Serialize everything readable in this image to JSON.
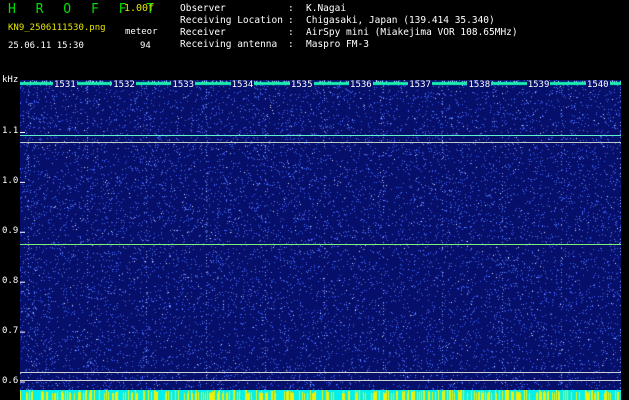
{
  "header": {
    "app_name": "H R O F F T",
    "version": "1.00f",
    "filename": "KN9_2506111530.png",
    "mode": "meteor",
    "datetime": "25.06.11 15:30",
    "count": "94",
    "info": [
      {
        "label": "Observer",
        "value": "K.Nagai"
      },
      {
        "label": "Receiving Location",
        "value": "Chigasaki, Japan (139.414 35.340)"
      },
      {
        "label": "Receiver",
        "value": "AirSpy mini (Miakejima VOR 108.65MHz)"
      },
      {
        "label": "Receiving antenna",
        "value": "Maspro FM-3"
      }
    ]
  },
  "spectrogram": {
    "y_unit": "kHz",
    "y_ticks": [
      {
        "label": "1.1",
        "value": 1.1
      },
      {
        "label": "1.0",
        "value": 1.0
      },
      {
        "label": "0.9",
        "value": 0.9
      },
      {
        "label": "0.8",
        "value": 0.8
      },
      {
        "label": "0.7",
        "value": 0.7
      },
      {
        "label": "0.6",
        "value": 0.6
      }
    ],
    "y_range": [
      0.58,
      1.205
    ],
    "time_labels": [
      "1531",
      "1532",
      "1533",
      "1534",
      "1535",
      "1536",
      "1537",
      "1538",
      "1539",
      "1540"
    ],
    "lines": [
      {
        "freq": 1.095,
        "color": "#5ff0d0"
      },
      {
        "freq": 1.08,
        "color": "#bfc8c0"
      },
      {
        "freq": 0.877,
        "color": "#7af07a"
      },
      {
        "freq": 0.62,
        "color": "#cfcfcf"
      },
      {
        "freq": 0.605,
        "color": "#cfcfcf"
      }
    ],
    "colors": {
      "background": "#06106a",
      "top_band": "#19f0b0",
      "noise": "#3c62ff",
      "footer": "#00f0f0",
      "footer_marks": "#f0f000"
    }
  }
}
